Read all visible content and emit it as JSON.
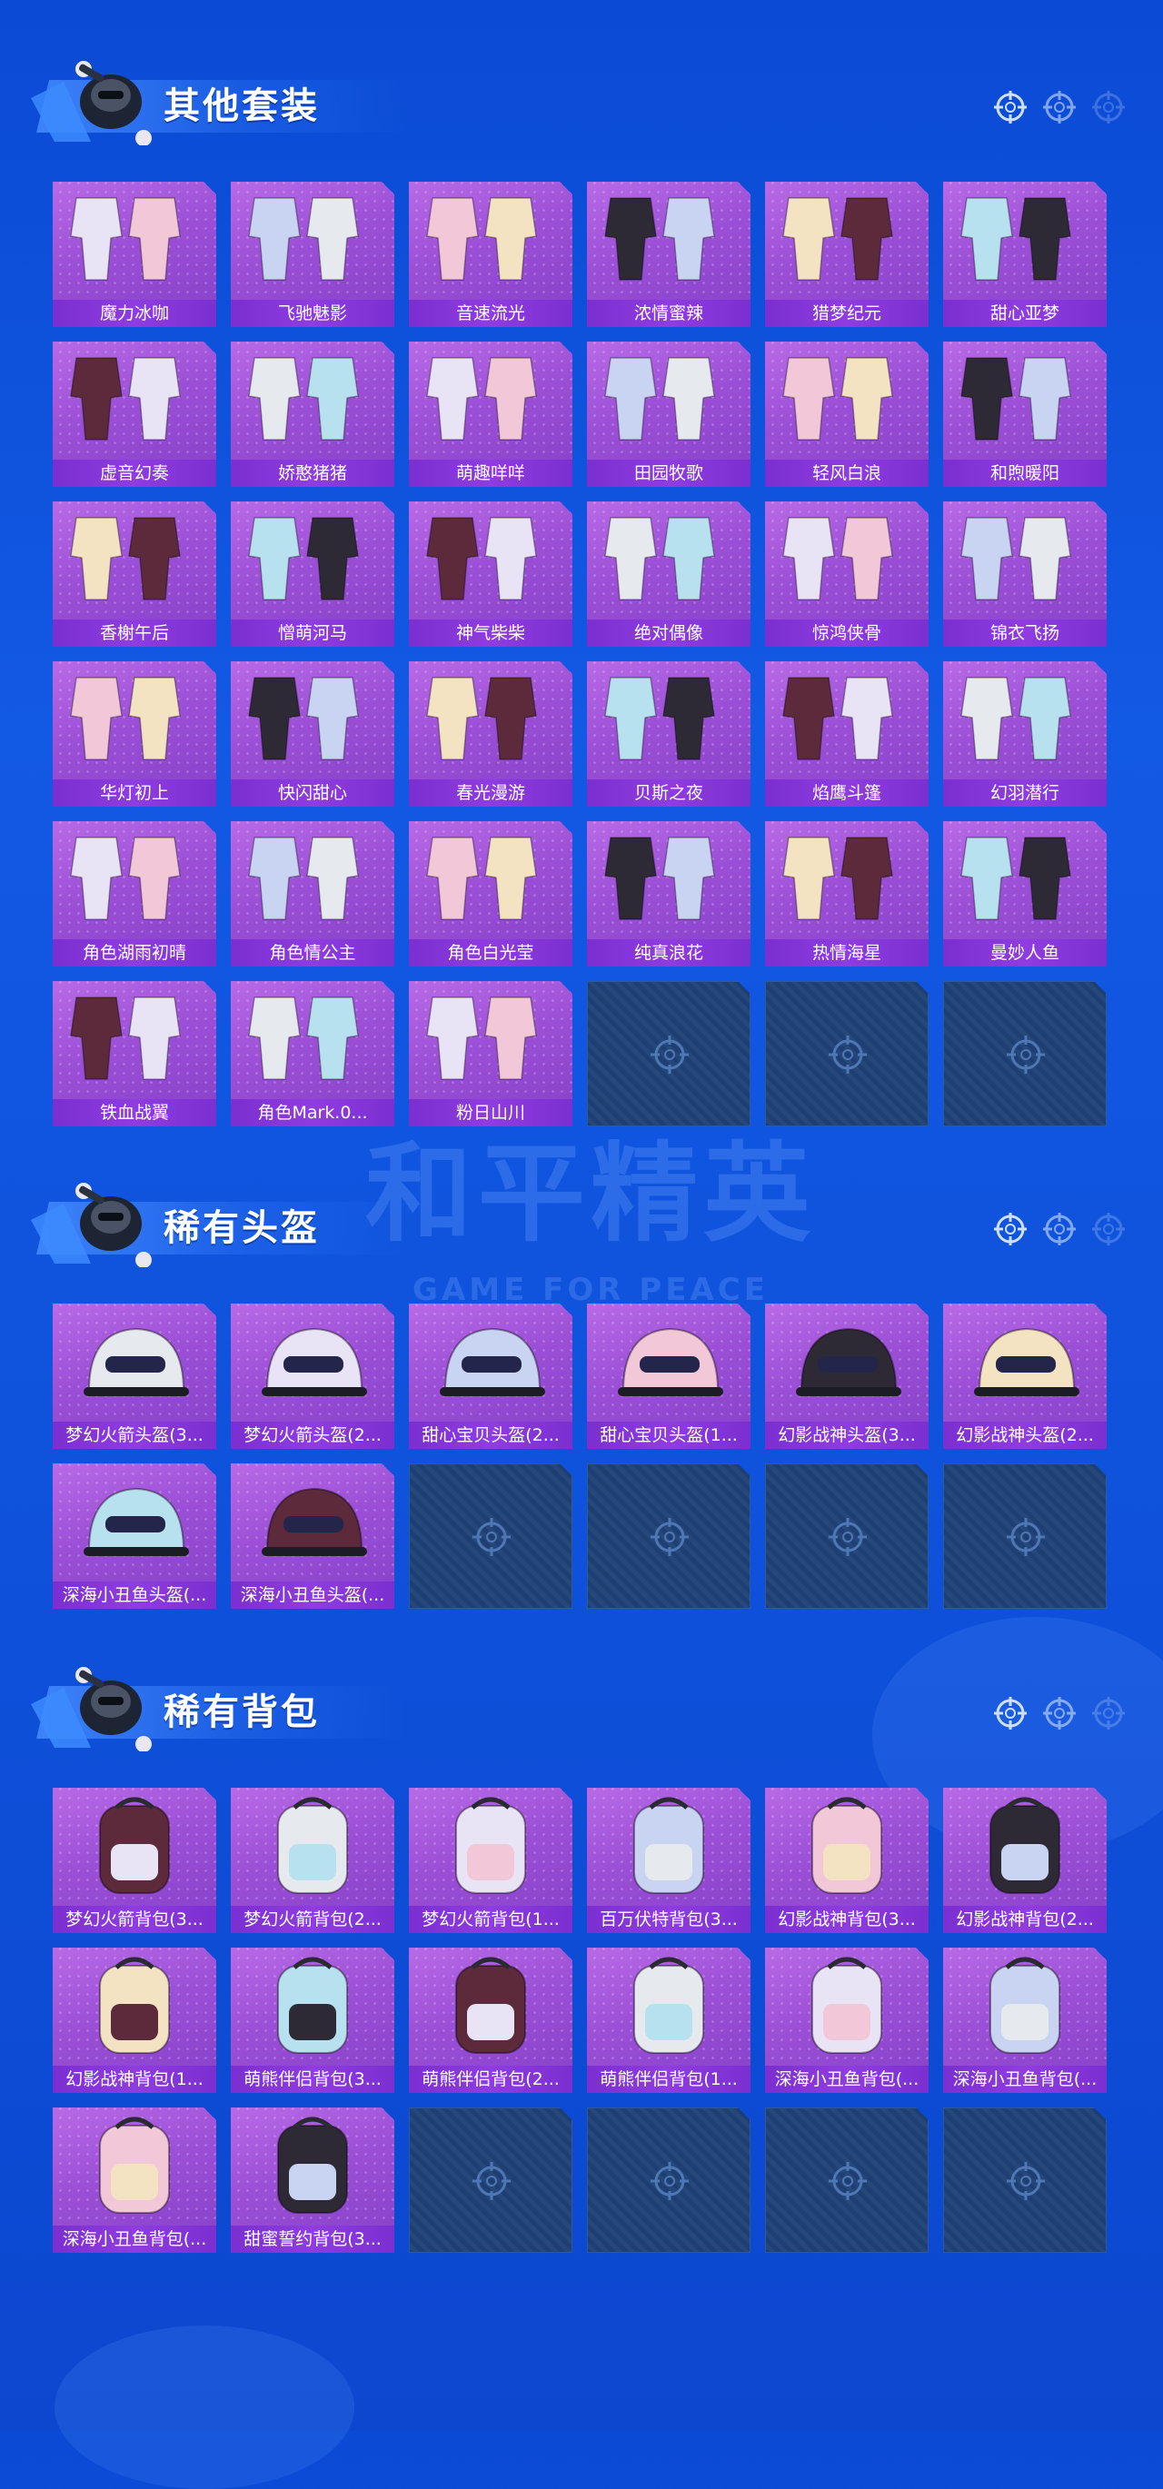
{
  "watermark": {
    "text": "和平精英",
    "sub": "GAME FOR PEACE"
  },
  "colors": {
    "bg": "#0f52dc",
    "card": "#9b4fd6",
    "label_bar": "#8f3ce0",
    "empty_card": "#1d3f74"
  },
  "sections": [
    {
      "title": "其他套装",
      "items": [
        "魔力冰咖",
        "飞驰魅影",
        "音速流光",
        "浓情蜜辣",
        "猎梦纪元",
        "甜心亚梦",
        "虚音幻奏",
        "娇憨猪猪",
        "萌趣咩咩",
        "田园牧歌",
        "轻风白浪",
        "和煦暖阳",
        "香榭午后",
        "憎萌河马",
        "神气柴柴",
        "绝对偶像",
        "惊鸿侠骨",
        "锦衣飞扬",
        "华灯初上",
        "快闪甜心",
        "春光漫游",
        "贝斯之夜",
        "焰鹰斗篷",
        "幻羽潜行",
        "角色湖雨初晴",
        "角色情公主",
        "角色白光莹",
        "纯真浪花",
        "热情海星",
        "曼妙人鱼",
        "铁血战翼",
        "角色Mark.0...",
        "粉日山川",
        "",
        "",
        ""
      ]
    },
    {
      "title": "稀有头盔",
      "items": [
        "梦幻火箭头盔(3...",
        "梦幻火箭头盔(2...",
        "甜心宝贝头盔(2...",
        "甜心宝贝头盔(1...",
        "幻影战神头盔(3...",
        "幻影战神头盔(2...",
        "深海小丑鱼头盔(...",
        "深海小丑鱼头盔(...",
        "",
        "",
        "",
        ""
      ]
    },
    {
      "title": "稀有背包",
      "items": [
        "梦幻火箭背包(3...",
        "梦幻火箭背包(2...",
        "梦幻火箭背包(1...",
        "百万伏特背包(3...",
        "幻影战神背包(3...",
        "幻影战神背包(2...",
        "幻影战神背包(1...",
        "萌熊伴侣背包(3...",
        "萌熊伴侣背包(2...",
        "萌熊伴侣背包(1...",
        "深海小丑鱼背包(...",
        "深海小丑鱼背包(...",
        "深海小丑鱼背包(...",
        "甜蜜誓约背包(3...",
        "",
        "",
        "",
        ""
      ]
    }
  ]
}
